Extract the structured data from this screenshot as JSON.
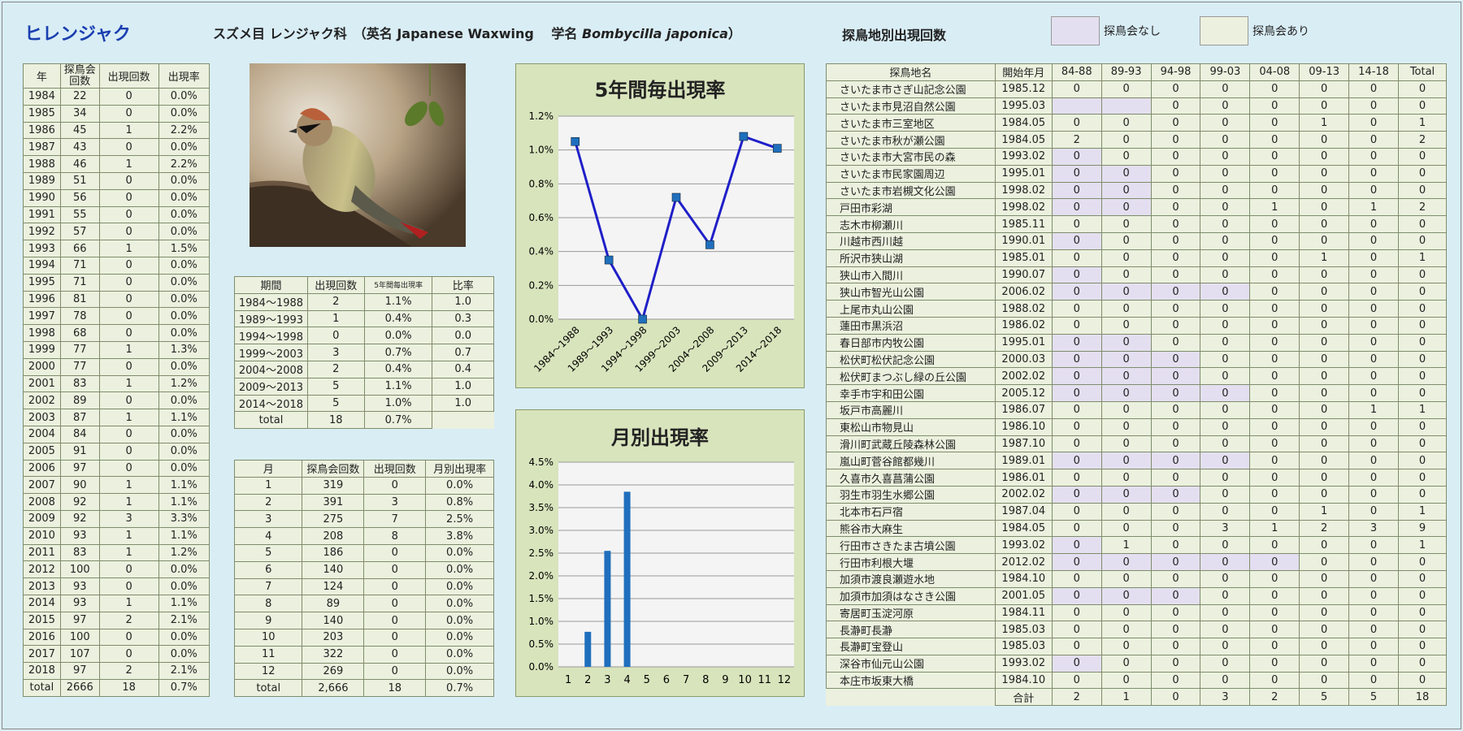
{
  "header": {
    "common_name": "ヒレンジャク",
    "species_line": "スズメ目 レンジャク科　（英名 Japanese Waxwing　 学名",
    "scientific_name": "Bombycilla japonica",
    "species_close": "）",
    "site_section_title": "探鳥地別出現回数",
    "legend_no_survey": "探鳥会なし",
    "legend_survey": "探鳥会あり"
  },
  "colors": {
    "no_survey": "#e4dff0",
    "survey": "#ebf1de",
    "panel": "#d8e4bc",
    "accent": "#1a3fb0",
    "line": "#1f1fc8",
    "bar": "#1f6fbd"
  },
  "photo": {
    "icon": "waxwing-bird-photo"
  },
  "year_table": {
    "headers": [
      "年",
      "探鳥会回数",
      "出現回数",
      "出現率"
    ],
    "rows": [
      [
        "1984",
        "22",
        "0",
        "0.0%"
      ],
      [
        "1985",
        "34",
        "0",
        "0.0%"
      ],
      [
        "1986",
        "45",
        "1",
        "2.2%"
      ],
      [
        "1987",
        "43",
        "0",
        "0.0%"
      ],
      [
        "1988",
        "46",
        "1",
        "2.2%"
      ],
      [
        "1989",
        "51",
        "0",
        "0.0%"
      ],
      [
        "1990",
        "56",
        "0",
        "0.0%"
      ],
      [
        "1991",
        "55",
        "0",
        "0.0%"
      ],
      [
        "1992",
        "57",
        "0",
        "0.0%"
      ],
      [
        "1993",
        "66",
        "1",
        "1.5%"
      ],
      [
        "1994",
        "71",
        "0",
        "0.0%"
      ],
      [
        "1995",
        "71",
        "0",
        "0.0%"
      ],
      [
        "1996",
        "81",
        "0",
        "0.0%"
      ],
      [
        "1997",
        "78",
        "0",
        "0.0%"
      ],
      [
        "1998",
        "68",
        "0",
        "0.0%"
      ],
      [
        "1999",
        "77",
        "1",
        "1.3%"
      ],
      [
        "2000",
        "77",
        "0",
        "0.0%"
      ],
      [
        "2001",
        "83",
        "1",
        "1.2%"
      ],
      [
        "2002",
        "89",
        "0",
        "0.0%"
      ],
      [
        "2003",
        "87",
        "1",
        "1.1%"
      ],
      [
        "2004",
        "84",
        "0",
        "0.0%"
      ],
      [
        "2005",
        "91",
        "0",
        "0.0%"
      ],
      [
        "2006",
        "97",
        "0",
        "0.0%"
      ],
      [
        "2007",
        "90",
        "1",
        "1.1%"
      ],
      [
        "2008",
        "92",
        "1",
        "1.1%"
      ],
      [
        "2009",
        "92",
        "3",
        "3.3%"
      ],
      [
        "2010",
        "93",
        "1",
        "1.1%"
      ],
      [
        "2011",
        "83",
        "1",
        "1.2%"
      ],
      [
        "2012",
        "100",
        "0",
        "0.0%"
      ],
      [
        "2013",
        "93",
        "0",
        "0.0%"
      ],
      [
        "2014",
        "93",
        "1",
        "1.1%"
      ],
      [
        "2015",
        "97",
        "2",
        "2.1%"
      ],
      [
        "2016",
        "100",
        "0",
        "0.0%"
      ],
      [
        "2017",
        "107",
        "0",
        "0.0%"
      ],
      [
        "2018",
        "97",
        "2",
        "2.1%"
      ],
      [
        "total",
        "2666",
        "18",
        "0.7%"
      ]
    ]
  },
  "period_table": {
    "headers": [
      "期間",
      "出現回数",
      "5年間毎出現率",
      "比率"
    ],
    "rows": [
      [
        "1984～1988",
        "2",
        "1.1%",
        "1.0"
      ],
      [
        "1989～1993",
        "1",
        "0.4%",
        "0.3"
      ],
      [
        "1994～1998",
        "0",
        "0.0%",
        "0.0"
      ],
      [
        "1999～2003",
        "3",
        "0.7%",
        "0.7"
      ],
      [
        "2004～2008",
        "2",
        "0.4%",
        "0.4"
      ],
      [
        "2009～2013",
        "5",
        "1.1%",
        "1.0"
      ],
      [
        "2014～2018",
        "5",
        "1.0%",
        "1.0"
      ],
      [
        "total",
        "18",
        "0.7%",
        ""
      ]
    ]
  },
  "month_table": {
    "headers": [
      "月",
      "探鳥会回数",
      "出現回数",
      "月別出現率"
    ],
    "rows": [
      [
        "1",
        "319",
        "0",
        "0.0%"
      ],
      [
        "2",
        "391",
        "3",
        "0.8%"
      ],
      [
        "3",
        "275",
        "7",
        "2.5%"
      ],
      [
        "4",
        "208",
        "8",
        "3.8%"
      ],
      [
        "5",
        "186",
        "0",
        "0.0%"
      ],
      [
        "6",
        "140",
        "0",
        "0.0%"
      ],
      [
        "7",
        "124",
        "0",
        "0.0%"
      ],
      [
        "8",
        "89",
        "0",
        "0.0%"
      ],
      [
        "9",
        "140",
        "0",
        "0.0%"
      ],
      [
        "10",
        "203",
        "0",
        "0.0%"
      ],
      [
        "11",
        "322",
        "0",
        "0.0%"
      ],
      [
        "12",
        "269",
        "0",
        "0.0%"
      ],
      [
        "total",
        "2,666",
        "18",
        "0.7%"
      ]
    ]
  },
  "chart_data": [
    {
      "type": "line",
      "title": "5年間毎出現率",
      "categories": [
        "1984～1988",
        "1989～1993",
        "1994～1998",
        "1999～2003",
        "2004～2008",
        "2009～2013",
        "2014～2018"
      ],
      "values": [
        1.05,
        0.35,
        0.0,
        0.72,
        0.44,
        1.08,
        1.01
      ],
      "yticks": [
        "0.0%",
        "0.2%",
        "0.4%",
        "0.6%",
        "0.8%",
        "1.0%",
        "1.2%"
      ],
      "ylim": [
        0,
        1.2
      ],
      "grid": true
    },
    {
      "type": "bar",
      "title": "月別出現率",
      "categories": [
        "1",
        "2",
        "3",
        "4",
        "5",
        "6",
        "7",
        "8",
        "9",
        "10",
        "11",
        "12"
      ],
      "values": [
        0.0,
        0.77,
        2.55,
        3.85,
        0,
        0,
        0,
        0,
        0,
        0,
        0,
        0
      ],
      "yticks": [
        "0.0%",
        "0.5%",
        "1.0%",
        "1.5%",
        "2.0%",
        "2.5%",
        "3.0%",
        "3.5%",
        "4.0%",
        "4.5%"
      ],
      "ylim": [
        0,
        4.5
      ],
      "grid": true
    }
  ],
  "site_table": {
    "headers": [
      "探鳥地名",
      "開始年月",
      "84-88",
      "89-93",
      "94-98",
      "99-03",
      "04-08",
      "09-13",
      "14-18",
      "Total"
    ],
    "rows": [
      {
        "c": [
          "さいたま市さぎ山記念公園",
          "1985.12",
          "0",
          "0",
          "0",
          "0",
          "0",
          "0",
          "0",
          "0"
        ],
        "h": []
      },
      {
        "c": [
          "さいたま市見沼自然公園",
          "1995.03",
          "",
          "",
          "0",
          "0",
          "0",
          "0",
          "0",
          "0"
        ],
        "h": [
          2,
          3
        ]
      },
      {
        "c": [
          "さいたま市三室地区",
          "1984.05",
          "0",
          "0",
          "0",
          "0",
          "0",
          "1",
          "0",
          "1"
        ],
        "h": []
      },
      {
        "c": [
          "さいたま市秋が瀬公園",
          "1984.05",
          "2",
          "0",
          "0",
          "0",
          "0",
          "0",
          "0",
          "2"
        ],
        "h": []
      },
      {
        "c": [
          "さいたま市大宮市民の森",
          "1993.02",
          "0",
          "0",
          "0",
          "0",
          "0",
          "0",
          "0",
          "0"
        ],
        "h": [
          2
        ]
      },
      {
        "c": [
          "さいたま市民家園周辺",
          "1995.01",
          "0",
          "0",
          "0",
          "0",
          "0",
          "0",
          "0",
          "0"
        ],
        "h": [
          2,
          3
        ]
      },
      {
        "c": [
          "さいたま市岩槻文化公園",
          "1998.02",
          "0",
          "0",
          "0",
          "0",
          "0",
          "0",
          "0",
          "0"
        ],
        "h": [
          2,
          3
        ]
      },
      {
        "c": [
          "戸田市彩湖",
          "1998.02",
          "0",
          "0",
          "0",
          "0",
          "1",
          "0",
          "1",
          "2"
        ],
        "h": [
          2,
          3
        ]
      },
      {
        "c": [
          "志木市柳瀬川",
          "1985.11",
          "0",
          "0",
          "0",
          "0",
          "0",
          "0",
          "0",
          "0"
        ],
        "h": []
      },
      {
        "c": [
          "川越市西川越",
          "1990.01",
          "0",
          "0",
          "0",
          "0",
          "0",
          "0",
          "0",
          "0"
        ],
        "h": [
          2
        ]
      },
      {
        "c": [
          "所沢市狭山湖",
          "1985.01",
          "0",
          "0",
          "0",
          "0",
          "0",
          "1",
          "0",
          "1"
        ],
        "h": []
      },
      {
        "c": [
          "狭山市入間川",
          "1990.07",
          "0",
          "0",
          "0",
          "0",
          "0",
          "0",
          "0",
          "0"
        ],
        "h": [
          2
        ]
      },
      {
        "c": [
          "狭山市智光山公園",
          "2006.02",
          "0",
          "0",
          "0",
          "0",
          "0",
          "0",
          "0",
          "0"
        ],
        "h": [
          2,
          3,
          4,
          5
        ]
      },
      {
        "c": [
          "上尾市丸山公園",
          "1988.02",
          "0",
          "0",
          "0",
          "0",
          "0",
          "0",
          "0",
          "0"
        ],
        "h": []
      },
      {
        "c": [
          "蓮田市黒浜沼",
          "1986.02",
          "0",
          "0",
          "0",
          "0",
          "0",
          "0",
          "0",
          "0"
        ],
        "h": []
      },
      {
        "c": [
          "春日部市内牧公園",
          "1995.01",
          "0",
          "0",
          "0",
          "0",
          "0",
          "0",
          "0",
          "0"
        ],
        "h": [
          2,
          3
        ]
      },
      {
        "c": [
          "松伏町松伏記念公園",
          "2000.03",
          "0",
          "0",
          "0",
          "0",
          "0",
          "0",
          "0",
          "0"
        ],
        "h": [
          2,
          3,
          4
        ]
      },
      {
        "c": [
          "松伏町まつぶし緑の丘公園",
          "2002.02",
          "0",
          "0",
          "0",
          "0",
          "0",
          "0",
          "0",
          "0"
        ],
        "h": [
          2,
          3,
          4
        ]
      },
      {
        "c": [
          "幸手市宇和田公園",
          "2005.12",
          "0",
          "0",
          "0",
          "0",
          "0",
          "0",
          "0",
          "0"
        ],
        "h": [
          2,
          3,
          4,
          5
        ]
      },
      {
        "c": [
          "坂戸市高麗川",
          "1986.07",
          "0",
          "0",
          "0",
          "0",
          "0",
          "0",
          "1",
          "1"
        ],
        "h": []
      },
      {
        "c": [
          "東松山市物見山",
          "1986.10",
          "0",
          "0",
          "0",
          "0",
          "0",
          "0",
          "0",
          "0"
        ],
        "h": []
      },
      {
        "c": [
          "滑川町武蔵丘陵森林公園",
          "1987.10",
          "0",
          "0",
          "0",
          "0",
          "0",
          "0",
          "0",
          "0"
        ],
        "h": []
      },
      {
        "c": [
          "嵐山町菅谷館都幾川",
          "1989.01",
          "0",
          "0",
          "0",
          "0",
          "0",
          "0",
          "0",
          "0"
        ],
        "h": [
          2,
          3,
          4,
          5
        ]
      },
      {
        "c": [
          "久喜市久喜菖蒲公園",
          "1986.01",
          "0",
          "0",
          "0",
          "0",
          "0",
          "0",
          "0",
          "0"
        ],
        "h": []
      },
      {
        "c": [
          "羽生市羽生水郷公園",
          "2002.02",
          "0",
          "0",
          "0",
          "0",
          "0",
          "0",
          "0",
          "0"
        ],
        "h": [
          2,
          3,
          4
        ]
      },
      {
        "c": [
          "北本市石戸宿",
          "1987.04",
          "0",
          "0",
          "0",
          "0",
          "0",
          "1",
          "0",
          "1"
        ],
        "h": []
      },
      {
        "c": [
          "熊谷市大麻生",
          "1984.05",
          "0",
          "0",
          "0",
          "3",
          "1",
          "2",
          "3",
          "9"
        ],
        "h": []
      },
      {
        "c": [
          "行田市さきたま古墳公園",
          "1993.02",
          "0",
          "1",
          "0",
          "0",
          "0",
          "0",
          "0",
          "1"
        ],
        "h": [
          2
        ]
      },
      {
        "c": [
          "行田市利根大堰",
          "2012.02",
          "0",
          "0",
          "0",
          "0",
          "0",
          "0",
          "0",
          "0"
        ],
        "h": [
          2,
          3,
          4,
          5,
          6
        ]
      },
      {
        "c": [
          "加須市渡良瀬遊水地",
          "1984.10",
          "0",
          "0",
          "0",
          "0",
          "0",
          "0",
          "0",
          "0"
        ],
        "h": []
      },
      {
        "c": [
          "加須市加須はなさき公園",
          "2001.05",
          "0",
          "0",
          "0",
          "0",
          "0",
          "0",
          "0",
          "0"
        ],
        "h": [
          2,
          3,
          4
        ]
      },
      {
        "c": [
          "寄居町玉淀河原",
          "1984.11",
          "0",
          "0",
          "0",
          "0",
          "0",
          "0",
          "0",
          "0"
        ],
        "h": []
      },
      {
        "c": [
          "長瀞町長瀞",
          "1985.03",
          "0",
          "0",
          "0",
          "0",
          "0",
          "0",
          "0",
          "0"
        ],
        "h": []
      },
      {
        "c": [
          "長瀞町宝登山",
          "1985.03",
          "0",
          "0",
          "0",
          "0",
          "0",
          "0",
          "0",
          "0"
        ],
        "h": []
      },
      {
        "c": [
          "深谷市仙元山公園",
          "1993.02",
          "0",
          "0",
          "0",
          "0",
          "0",
          "0",
          "0",
          "0"
        ],
        "h": [
          2
        ]
      },
      {
        "c": [
          "本庄市坂東大橋",
          "1984.10",
          "0",
          "0",
          "0",
          "0",
          "0",
          "0",
          "0",
          "0"
        ],
        "h": []
      }
    ],
    "total_label": "合計",
    "totals": [
      "2",
      "1",
      "0",
      "3",
      "2",
      "5",
      "5",
      "18"
    ]
  }
}
